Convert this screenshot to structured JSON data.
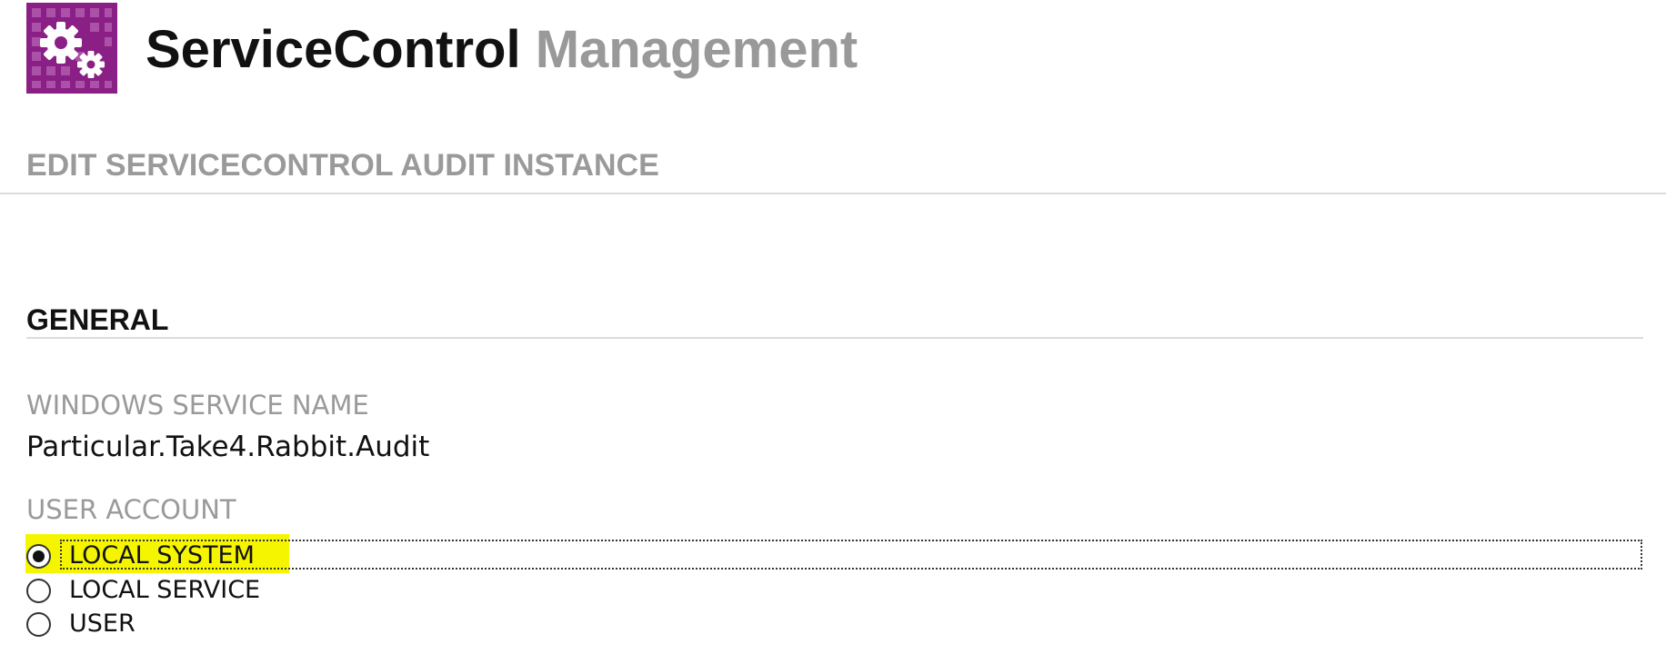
{
  "header": {
    "logo_icon": "gears-icon",
    "brand_color": "#8a1f86",
    "title_primary": "ServiceControl",
    "title_secondary": "Management"
  },
  "page": {
    "heading": "EDIT SERVICECONTROL AUDIT INSTANCE"
  },
  "general": {
    "section_title": "GENERAL",
    "service_name": {
      "label": "WINDOWS SERVICE NAME",
      "value": "Particular.Take4.Rabbit.Audit"
    },
    "user_account": {
      "label": "USER ACCOUNT",
      "selected": "LOCAL SYSTEM",
      "options": [
        {
          "label": "LOCAL SYSTEM",
          "checked": true
        },
        {
          "label": "LOCAL SERVICE",
          "checked": false
        },
        {
          "label": "USER",
          "checked": false
        }
      ]
    }
  },
  "colors": {
    "highlight": "#f5f500",
    "muted_text": "#9a9a9a"
  }
}
